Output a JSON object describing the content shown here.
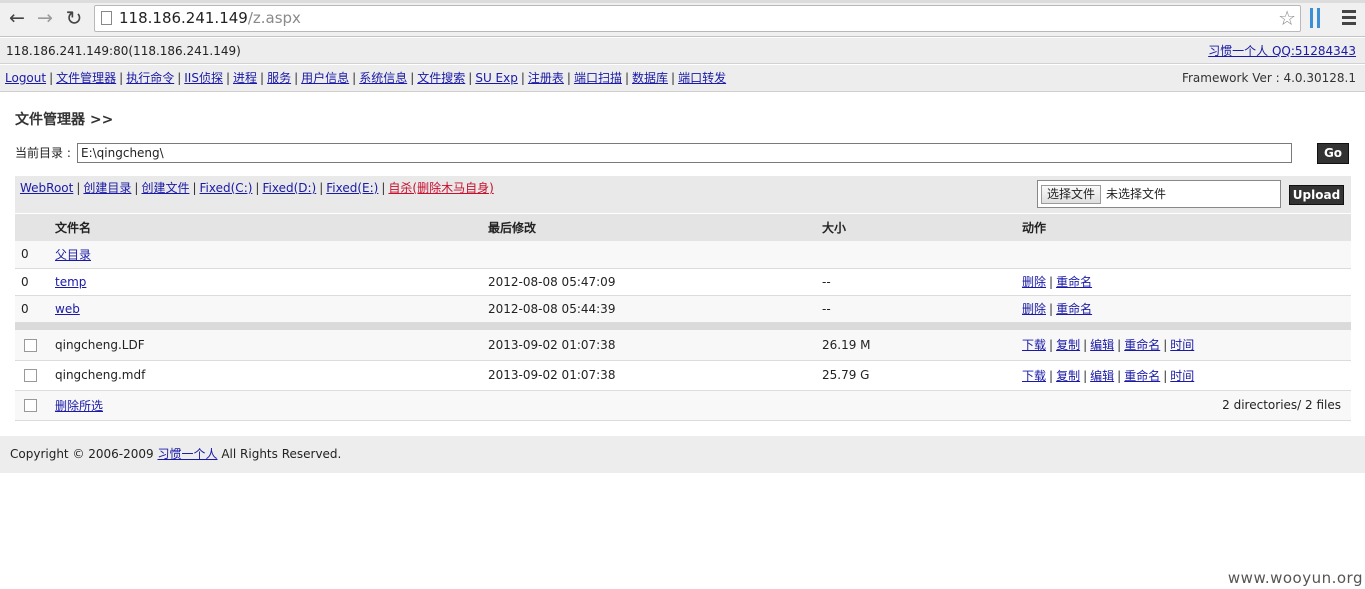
{
  "browser": {
    "url_host": "118.186.241.149",
    "url_path": "/z.aspx"
  },
  "header": {
    "host_info": "118.186.241.149:80(118.186.241.149)",
    "author_link": "习惯一个人 QQ:51284343"
  },
  "nav": {
    "items": [
      "Logout",
      "文件管理器",
      "执行命令",
      "IIS侦探",
      "进程",
      "服务",
      "用户信息",
      "系统信息",
      "文件搜索",
      "SU Exp",
      "注册表",
      "端口扫描",
      "数据库",
      "端口转发"
    ],
    "framework": "Framework Ver : 4.0.30128.1"
  },
  "main": {
    "title": "文件管理器 >>",
    "dir_label": "当前目录 :",
    "dir_value": "E:\\qingcheng\\",
    "go_label": "Go",
    "tools": [
      "WebRoot",
      "创建目录",
      "创建文件",
      "Fixed(C:)",
      "Fixed(D:)",
      "Fixed(E:)",
      "自杀(删除木马自身)"
    ],
    "choose_file": "选择文件",
    "no_file": "未选择文件",
    "upload_label": "Upload"
  },
  "table": {
    "headers": [
      "文件名",
      "最后修改",
      "大小",
      "动作"
    ],
    "parent_dir": {
      "index": "0",
      "name": "父目录"
    },
    "dirs": [
      {
        "index": "0",
        "name": "temp",
        "modified": "2012-08-08 05:47:09",
        "size": "--",
        "actions": [
          "删除",
          "重命名"
        ]
      },
      {
        "index": "0",
        "name": "web",
        "modified": "2012-08-08 05:44:39",
        "size": "--",
        "actions": [
          "删除",
          "重命名"
        ]
      }
    ],
    "files": [
      {
        "name": "qingcheng.LDF",
        "modified": "2013-09-02 01:07:38",
        "size": "26.19 M",
        "actions": [
          "下载",
          "复制",
          "编辑",
          "重命名",
          "时间"
        ]
      },
      {
        "name": "qingcheng.mdf",
        "modified": "2013-09-02 01:07:38",
        "size": "25.79 G",
        "actions": [
          "下载",
          "复制",
          "编辑",
          "重命名",
          "时间"
        ]
      }
    ],
    "delete_selected": "删除所选",
    "summary": "2 directories/ 2 files"
  },
  "footer": {
    "copyright": "Copyright © 2006-2009",
    "author": "习惯一个人",
    "rights": "All Rights Reserved."
  },
  "watermark": "www.wooyun.org",
  "colors": {
    "link": "#1a1aa6",
    "danger_link": "#c8102e",
    "button_dark": "#333333"
  }
}
